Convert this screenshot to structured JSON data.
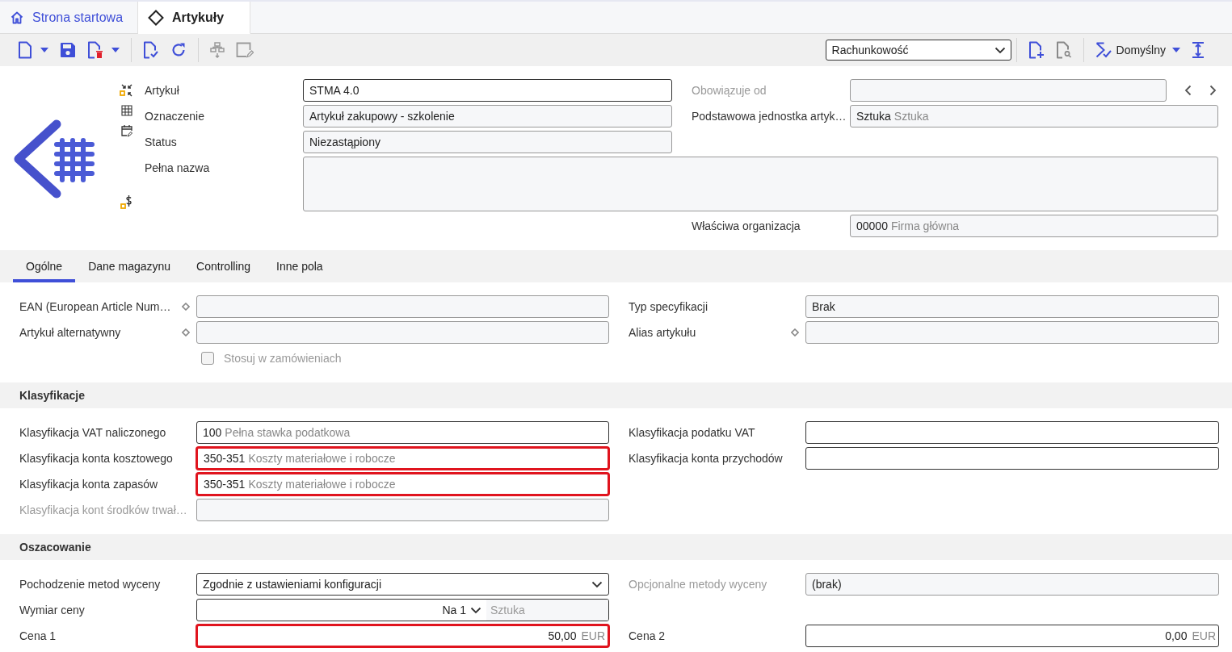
{
  "tabs": [
    {
      "label": "Strona startowa",
      "selected": false
    },
    {
      "label": "Artykuły",
      "selected": true
    }
  ],
  "toolbar": {
    "view_select": "Rachunkowość",
    "profile": "Domyślny"
  },
  "header": {
    "rows": [
      {
        "left": {
          "label": "Artykuł",
          "kind": "text",
          "value": "STMA 4.0",
          "readonly": false,
          "disabled": false,
          "highlighted": false
        },
        "right": {
          "label": "Obowiązuje od",
          "kind": "text",
          "readonly": true,
          "disabled": true,
          "highlighted": false
        }
      },
      {
        "left": {
          "label": "Oznaczenie",
          "kind": "text",
          "value": "Artykuł zakupowy - szkolenie",
          "readonly": true,
          "disabled": false,
          "highlighted": false
        },
        "right": {
          "label": "Podstawowa jednostka artyk…",
          "kind": "text",
          "value": "Sztuka",
          "desc": "Sztuka",
          "readonly": true,
          "disabled": false,
          "highlighted": false
        }
      },
      {
        "left": {
          "label": "Status",
          "kind": "text",
          "value": "Niezastąpiony",
          "readonly": true,
          "disabled": false,
          "highlighted": false
        }
      },
      {
        "wide": {
          "label": "Pełna nazwa",
          "kind": "textarea",
          "readonly": true,
          "disabled": false,
          "highlighted": false
        }
      },
      {
        "right": {
          "label": "Właściwa organizacja",
          "kind": "text",
          "value": "00000",
          "desc": "Firma główna",
          "readonly": true,
          "disabled": false,
          "highlighted": false
        }
      }
    ]
  },
  "detail_tabs": [
    {
      "label": "Ogólne",
      "selected": true
    },
    {
      "label": "Dane magazynu",
      "selected": false
    },
    {
      "label": "Controlling",
      "selected": false
    },
    {
      "label": "Inne pola",
      "selected": false
    }
  ],
  "sections": [
    {
      "rows": [
        {
          "left": {
            "label": "EAN (European Article Num…",
            "marker": true,
            "kind": "text",
            "readonly": true,
            "disabled": false,
            "highlighted": false
          },
          "right": {
            "label": "Typ specyfikacji",
            "marker": false,
            "kind": "text",
            "value": "Brak",
            "readonly": true,
            "disabled": false,
            "highlighted": false
          }
        },
        {
          "left": {
            "label": "Artykuł alternatywny",
            "marker": true,
            "kind": "text",
            "readonly": true,
            "disabled": false,
            "highlighted": false
          },
          "right": {
            "label": "Alias artykułu",
            "marker": true,
            "kind": "text",
            "readonly": true,
            "disabled": false,
            "highlighted": false
          }
        },
        {
          "left": {
            "label": "Stosuj w zamówieniach",
            "kind": "checkbox",
            "checked": false,
            "disabled": true
          }
        }
      ]
    },
    {
      "title": "Klasyfikacje",
      "rows": [
        {
          "left": {
            "label": "Klasyfikacja VAT naliczonego",
            "kind": "text",
            "value": "100",
            "desc": "Pełna stawka podatkowa",
            "readonly": false,
            "disabled": false,
            "highlighted": false
          },
          "right": {
            "label": "Klasyfikacja podatku VAT",
            "kind": "text",
            "readonly": false,
            "disabled": false,
            "highlighted": false
          }
        },
        {
          "left": {
            "label": "Klasyfikacja konta kosztowego",
            "kind": "text",
            "value": "350-351",
            "desc": "Koszty materiałowe i robocze",
            "readonly": false,
            "disabled": false,
            "highlighted": true
          },
          "right": {
            "label": "Klasyfikacja konta przychodów",
            "kind": "text",
            "readonly": false,
            "disabled": false,
            "highlighted": false
          }
        },
        {
          "left": {
            "label": "Klasyfikacja konta zapasów",
            "kind": "text",
            "value": "350-351",
            "desc": "Koszty materiałowe i robocze",
            "readonly": false,
            "disabled": false,
            "highlighted": true
          }
        },
        {
          "left": {
            "label": "Klasyfikacja kont środków trwał…",
            "kind": "text",
            "readonly": true,
            "disabled": true,
            "highlighted": false
          }
        }
      ]
    },
    {
      "title": "Oszacowanie",
      "rows": [
        {
          "left": {
            "label": "Pochodzenie metod wyceny",
            "kind": "select",
            "value": "Zgodnie z ustawieniami konfiguracji",
            "readonly": false,
            "disabled": false,
            "highlighted": false
          },
          "right": {
            "label": "Opcjonalne metody wyceny",
            "kind": "text",
            "value": "(brak)",
            "readonly": true,
            "disabled": true,
            "highlighted": false
          }
        },
        {
          "left": {
            "label": "Wymiar ceny",
            "kind": "unit",
            "value": "Na 1",
            "desc": "Sztuka",
            "readonly": false,
            "disabled": false,
            "highlighted": false
          }
        },
        {
          "left": {
            "label": "Cena 1",
            "kind": "amount",
            "value": "50,00",
            "desc": "EUR",
            "readonly": false,
            "disabled": false,
            "highlighted": true
          },
          "right": {
            "label": "Cena 2",
            "kind": "amount",
            "value": "0,00",
            "desc": "EUR",
            "readonly": false,
            "disabled": false,
            "highlighted": false
          }
        }
      ]
    }
  ]
}
